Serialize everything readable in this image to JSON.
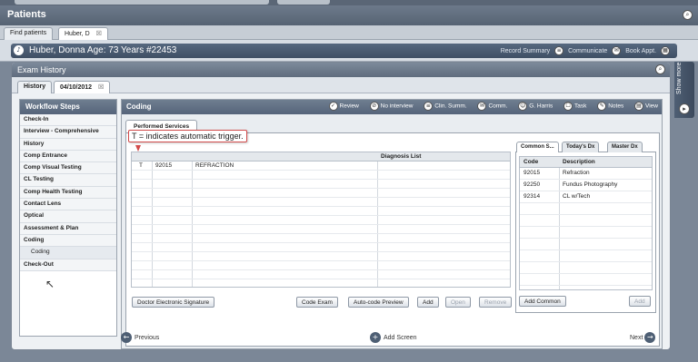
{
  "app": {
    "title": "Patients"
  },
  "patient_tabs": [
    {
      "label": "Find patients"
    },
    {
      "label": "Huber, D",
      "close": "☒"
    }
  ],
  "patient": {
    "header": "Huber, Donna   Age: 73 Years  #22453",
    "actions": [
      "Record Summary",
      "Communicate",
      "Book Appt."
    ]
  },
  "exam": {
    "title": "Exam History",
    "tabs": [
      {
        "label": "History"
      },
      {
        "label": "04/10/2012",
        "close": "☒"
      }
    ]
  },
  "workflow": {
    "title": "Workflow Steps",
    "items": [
      {
        "label": "Check-In"
      },
      {
        "label": "Interview - Comprehensive"
      },
      {
        "label": "History"
      },
      {
        "label": "Comp Entrance"
      },
      {
        "label": "Comp Visual Testing"
      },
      {
        "label": "CL Testing"
      },
      {
        "label": "Comp Health Testing"
      },
      {
        "label": "Contact Lens"
      },
      {
        "label": "Optical"
      },
      {
        "label": "Assessment & Plan"
      },
      {
        "label": "Coding"
      },
      {
        "label": "Coding",
        "sub": true
      },
      {
        "label": "Check-Out"
      }
    ]
  },
  "coding": {
    "title": "Coding",
    "toolbar": [
      "Review",
      "No interview",
      "Clin. Summ.",
      "Comm.",
      "G. Harris",
      "Task",
      "Notes",
      "View"
    ],
    "tab": "Performed Services",
    "tooltip": "T = indicates automatic trigger.",
    "grid_headers": {
      "diagnosis": "Diagnosis List"
    },
    "rows": [
      {
        "flag": "T",
        "code": "92015",
        "description": "REFRACTION"
      }
    ],
    "buttons": {
      "sign": "Doctor Electronic Signature",
      "code_exam": "Code Exam",
      "auto_code": "Auto-code Preview",
      "add": "Add",
      "open": "Open",
      "remove": "Remove"
    }
  },
  "dx": {
    "tabs": [
      "Common S...",
      "Today's Dx",
      "Master Dx"
    ],
    "headers": {
      "code": "Code",
      "description": "Description"
    },
    "rows": [
      {
        "code": "92015",
        "description": "Refraction"
      },
      {
        "code": "92250",
        "description": "Fundus Photography"
      },
      {
        "code": "92314",
        "description": "CL w/Tech"
      }
    ],
    "buttons": {
      "add_common": "Add Common",
      "add": "Add"
    }
  },
  "nav": {
    "previous": "Previous",
    "add_screen": "Add Screen",
    "next": "Next"
  },
  "show_more": "Show more"
}
